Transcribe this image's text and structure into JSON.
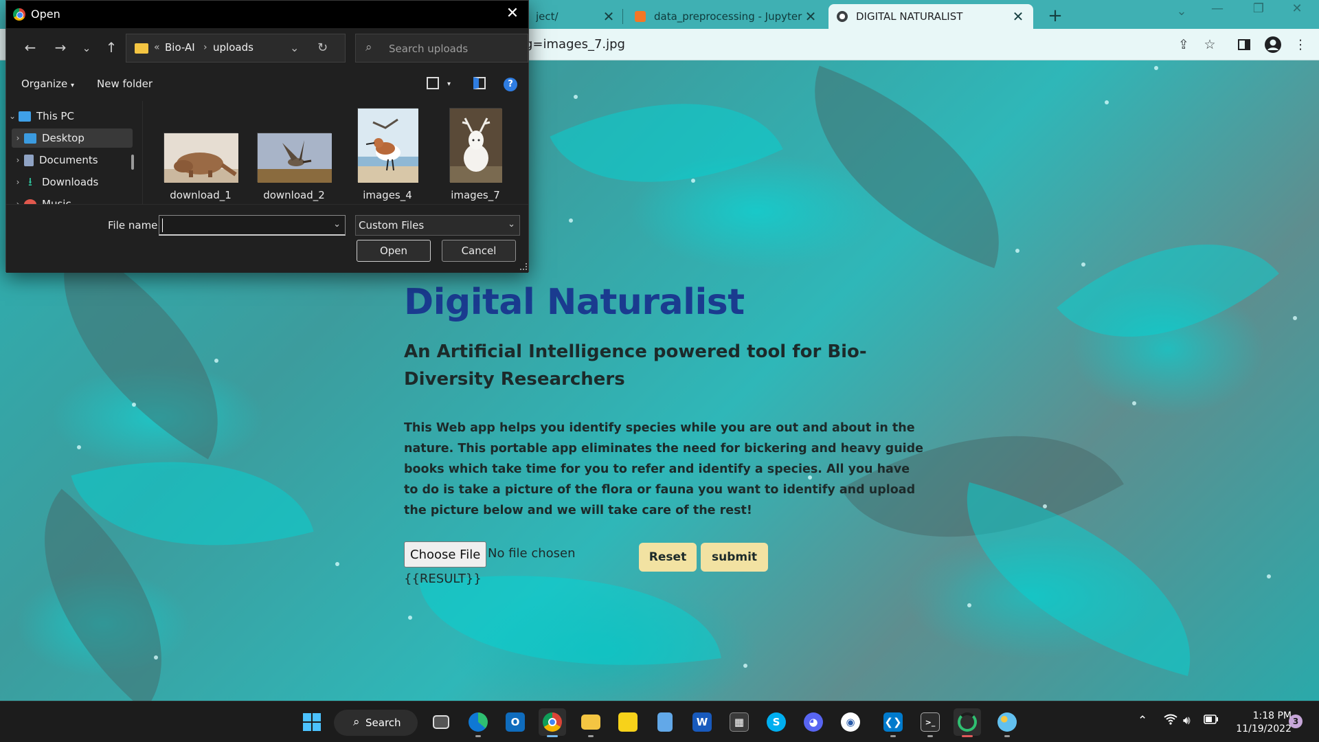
{
  "browser": {
    "tabs": [
      {
        "title": "ject/",
        "active": false
      },
      {
        "title": "data_preprocessing - Jupyter No",
        "active": false
      },
      {
        "title": "DIGITAL NATURALIST",
        "active": true
      }
    ],
    "address_fragment": "g=images_7.jpg",
    "new_tab_glyph": "+",
    "close_glyph": "✕"
  },
  "page": {
    "title": "Digital Naturalist",
    "subtitle": "An Artificial Intelligence powered tool for Bio-Diversity Researchers",
    "description": "This Web app helps you identify species while you are out and about in the nature. This portable app eliminates the need for bickering and heavy guide books which take time for you to refer and identify a species. All you have to do is take a picture of the flora or fauna you want to identify and upload the picture below and we will take care of the rest!",
    "choose_file_label": "Choose File",
    "file_status": "No file chosen",
    "reset_label": "Reset",
    "submit_label": "submit",
    "result_placeholder": "{{RESULT}}",
    "colors": {
      "title": "#1a3b8f",
      "button": "#f2e2a2",
      "background_accent": "#2bb3b4"
    }
  },
  "dialog": {
    "title": "Open",
    "path": [
      "Bio-AI",
      "uploads"
    ],
    "search_placeholder": "Search uploads",
    "organize_label": "Organize",
    "new_folder_label": "New folder",
    "nav": [
      {
        "label": "This PC",
        "icon": "pc-icon"
      },
      {
        "label": "Desktop",
        "icon": "desktop-icon"
      },
      {
        "label": "Documents",
        "icon": "documents-icon"
      },
      {
        "label": "Downloads",
        "icon": "downloads-icon"
      },
      {
        "label": "Music",
        "icon": "music-icon"
      }
    ],
    "files": [
      {
        "name": "download_1",
        "subject": "pangolin"
      },
      {
        "name": "download_2",
        "subject": "bird in flight"
      },
      {
        "name": "images_4",
        "subject": "sandpiper"
      },
      {
        "name": "images_7",
        "subject": "white deer"
      }
    ],
    "file_name_label": "File name:",
    "file_name_value": "",
    "file_type": "Custom Files",
    "open_label": "Open",
    "cancel_label": "Cancel",
    "help_glyph": "?"
  },
  "taskbar": {
    "search_label": "Search",
    "apps": [
      "start-icon",
      "task-view-icon",
      "edge-icon",
      "outlook-icon",
      "chrome-icon",
      "file-explorer-icon",
      "sticky-notes-icon",
      "notepad-icon",
      "word-icon",
      "calculator-icon",
      "skype-icon",
      "discord-icon",
      "wordpad-icon",
      "vscode-icon",
      "terminal-icon",
      "spinner-app-icon",
      "paint-icon"
    ],
    "word_glyph": "W",
    "skype_glyph": "S",
    "time": "1:18 PM",
    "date": "11/19/2022",
    "notification_count": "3"
  }
}
